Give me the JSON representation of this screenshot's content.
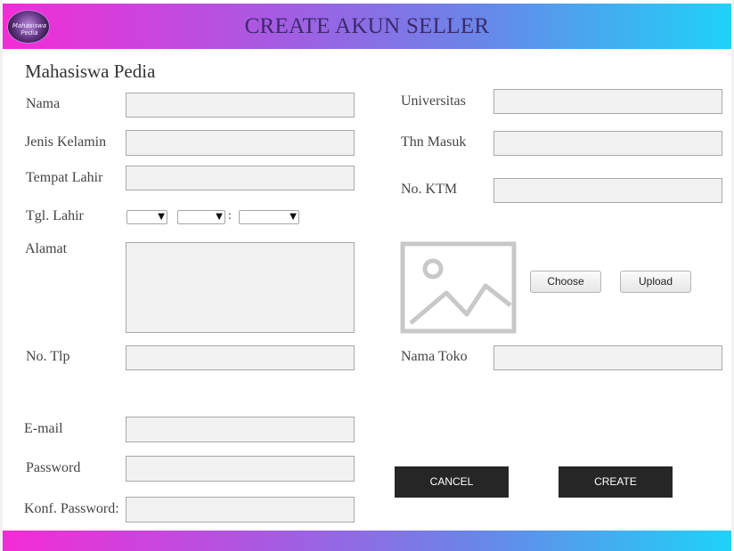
{
  "header": {
    "title": "CREATE AKUN SELLER",
    "logo_text": "Mahasiswa Pedia"
  },
  "app_name": "Mahasiswa Pedia",
  "form": {
    "nama": {
      "label": "Nama",
      "value": ""
    },
    "jenis_kelamin": {
      "label": "Jenis Kelamin",
      "value": ""
    },
    "tempat_lahir": {
      "label": "Tempat Lahir",
      "value": ""
    },
    "tgl_lahir": {
      "label": "Tgl. Lahir",
      "separator": ":",
      "day": "",
      "month": "",
      "year": ""
    },
    "alamat": {
      "label": "Alamat",
      "value": ""
    },
    "no_tlp": {
      "label": "No. Tlp",
      "value": ""
    },
    "email": {
      "label": "E-mail",
      "value": ""
    },
    "password": {
      "label": "Password",
      "value": ""
    },
    "konf_password": {
      "label": "Konf. Password:",
      "value": ""
    },
    "universitas": {
      "label": "Universitas",
      "value": ""
    },
    "thn_masuk": {
      "label": "Thn Masuk",
      "value": ""
    },
    "no_ktm": {
      "label": "No. KTM",
      "value": ""
    },
    "nama_toko": {
      "label": "Nama Toko",
      "value": ""
    }
  },
  "photo": {
    "icon": "image-placeholder-icon",
    "choose_label": "Choose",
    "upload_label": "Upload"
  },
  "actions": {
    "cancel_label": "CANCEL",
    "create_label": "CREATE"
  },
  "colors": {
    "gradient_start": "#f52bd6",
    "gradient_mid": "#a55ce2",
    "gradient_end": "#1fd2f8",
    "button_dark": "#262626",
    "field_bg": "#f2f2f2"
  }
}
